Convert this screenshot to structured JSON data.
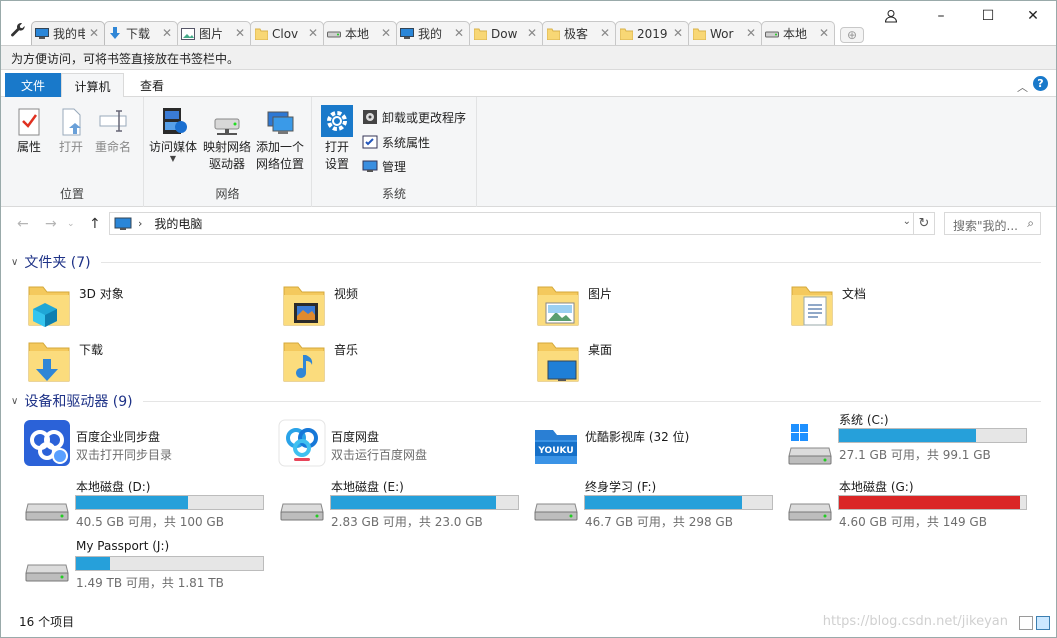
{
  "window": {
    "tabs": [
      {
        "label": "我的电脑",
        "icon": "computer-icon",
        "active": true
      },
      {
        "label": "下载",
        "icon": "download-arrow-icon"
      },
      {
        "label": "图片",
        "icon": "picture-icon"
      },
      {
        "label": "Clov",
        "icon": "folder-icon"
      },
      {
        "label": "本地",
        "icon": "drive-icon"
      },
      {
        "label": "我的",
        "icon": "computer-icon"
      },
      {
        "label": "Dow",
        "icon": "folder-icon"
      },
      {
        "label": "极客",
        "icon": "folder-icon"
      },
      {
        "label": "2019",
        "icon": "folder-icon"
      },
      {
        "label": "Wor",
        "icon": "folder-icon"
      },
      {
        "label": "本地",
        "icon": "drive-icon"
      }
    ],
    "minimize": "–",
    "maximize": "☐",
    "close": "✕"
  },
  "bookmark_bar": {
    "text": "为方便访问，可将书签直接放在书签栏中。"
  },
  "ribbon": {
    "tabs": {
      "file": "文件",
      "computer": "计算机",
      "view": "查看"
    },
    "groups": {
      "location": {
        "title": "位置",
        "properties": "属性",
        "open": "打开",
        "rename": "重命名"
      },
      "network": {
        "title": "网络",
        "access_media": "访问媒体",
        "map_drive_1": "映射网络",
        "map_drive_2": "驱动器",
        "add_location_1": "添加一个",
        "add_location_2": "网络位置"
      },
      "system": {
        "title": "系统",
        "open_settings_1": "打开",
        "open_settings_2": "设置",
        "uninstall": "卸载或更改程序",
        "system_properties": "系统属性",
        "manage": "管理"
      }
    }
  },
  "address": {
    "path": "我的电脑",
    "search_placeholder": "搜索\"我的..."
  },
  "folders": {
    "header": "文件夹 (7)",
    "items": [
      {
        "name": "3D 对象",
        "icon": "3d-objects-folder-icon"
      },
      {
        "name": "视频",
        "icon": "videos-folder-icon"
      },
      {
        "name": "图片",
        "icon": "pictures-folder-icon"
      },
      {
        "name": "文档",
        "icon": "documents-folder-icon"
      },
      {
        "name": "下载",
        "icon": "downloads-folder-icon"
      },
      {
        "name": "音乐",
        "icon": "music-folder-icon"
      },
      {
        "name": "桌面",
        "icon": "desktop-folder-icon"
      }
    ]
  },
  "devices": {
    "header": "设备和驱动器 (9)",
    "items": [
      {
        "name": "百度企业同步盘",
        "sub": "双击打开同步目录",
        "icon": "baidu-enterprise-sync-icon"
      },
      {
        "name": "百度网盘",
        "sub": "双击运行百度网盘",
        "icon": "baidu-netdisk-icon"
      },
      {
        "name": "优酷影视库 (32 位)",
        "icon": "youku-icon",
        "logo_text": "YOUKU"
      },
      {
        "name": "系统 (C:)",
        "sub": "27.1 GB 可用，共 99.1 GB",
        "icon": "windows-drive-icon",
        "used_fraction": 0.73
      },
      {
        "name": "本地磁盘 (D:)",
        "sub": "40.5 GB 可用，共 100 GB",
        "icon": "drive-icon",
        "used_fraction": 0.6
      },
      {
        "name": "本地磁盘 (E:)",
        "sub": "2.83 GB 可用，共 23.0 GB",
        "icon": "drive-icon",
        "used_fraction": 0.88
      },
      {
        "name": "终身学习 (F:)",
        "sub": "46.7 GB 可用，共 298 GB",
        "icon": "drive-icon",
        "used_fraction": 0.84
      },
      {
        "name": "本地磁盘 (G:)",
        "sub": "4.60 GB 可用，共 149 GB",
        "icon": "drive-icon",
        "used_fraction": 0.97,
        "full": true
      },
      {
        "name": "My Passport (J:)",
        "sub": "1.49 TB 可用，共 1.81 TB",
        "icon": "drive-icon",
        "used_fraction": 0.18
      }
    ]
  },
  "status": {
    "count": "16 个项目"
  },
  "watermark": "https://blog.csdn.net/jikeyan"
}
